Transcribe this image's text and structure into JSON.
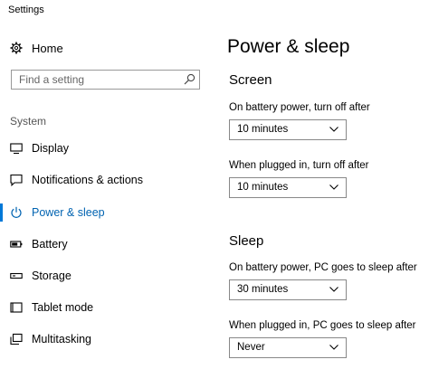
{
  "window": {
    "title": "Settings"
  },
  "sidebar": {
    "home_label": "Home",
    "search_placeholder": "Find a setting",
    "section": "System",
    "items": [
      {
        "label": "Display",
        "icon": "monitor-icon"
      },
      {
        "label": "Notifications & actions",
        "icon": "message-icon"
      },
      {
        "label": "Power & sleep",
        "icon": "power-icon",
        "active": true
      },
      {
        "label": "Battery",
        "icon": "battery-icon"
      },
      {
        "label": "Storage",
        "icon": "storage-icon"
      },
      {
        "label": "Tablet mode",
        "icon": "tablet-icon"
      },
      {
        "label": "Multitasking",
        "icon": "multitasking-icon"
      }
    ]
  },
  "main": {
    "title": "Power & sleep",
    "screen": {
      "heading": "Screen",
      "battery_label": "On battery power, turn off after",
      "battery_value": "10 minutes",
      "plugged_label": "When plugged in, turn off after",
      "plugged_value": "10 minutes"
    },
    "sleep": {
      "heading": "Sleep",
      "battery_label": "On battery power, PC goes to sleep after",
      "battery_value": "30 minutes",
      "plugged_label": "When plugged in, PC goes to sleep after",
      "plugged_value": "Never"
    }
  },
  "colors": {
    "accent": "#0078d7",
    "active_text": "#0063b1"
  }
}
